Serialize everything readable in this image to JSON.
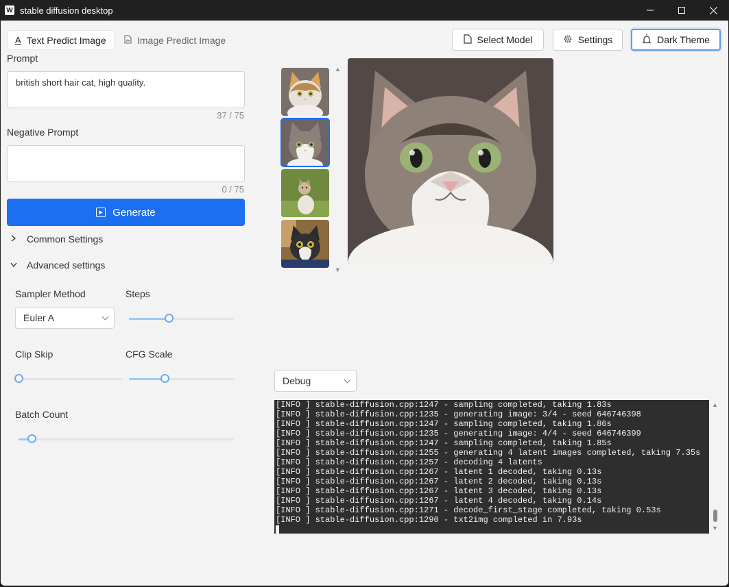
{
  "window": {
    "app_icon": "W",
    "title": "stable diffusion desktop",
    "minimize_icon": "minimize-icon",
    "maximize_icon": "maximize-icon",
    "close_icon": "close-icon"
  },
  "tabs": [
    {
      "label": "Text Predict Image",
      "icon": "text-icon",
      "active": true
    },
    {
      "label": "Image Predict Image",
      "icon": "image-file-icon",
      "active": false
    }
  ],
  "toolbar": {
    "select_model": "Select Model",
    "settings": "Settings",
    "dark_theme": "Dark Theme"
  },
  "prompt": {
    "label": "Prompt",
    "value": "british short hair cat, high quality.",
    "counter": "37 / 75"
  },
  "negative_prompt": {
    "label": "Negative Prompt",
    "value": "",
    "counter": "0 / 75"
  },
  "generate_label": "Generate",
  "common_settings": "Common Settings",
  "advanced_settings": "Advanced settings",
  "sampler": {
    "label": "Sampler Method",
    "value": "Euler A"
  },
  "steps": {
    "label": "Steps",
    "level": 0.38
  },
  "clip_skip": {
    "label": "Clip Skip",
    "level": 0.0
  },
  "cfg_scale": {
    "label": "CFG Scale",
    "level": 0.34
  },
  "batch_count": {
    "label": "Batch Count",
    "level": 0.06
  },
  "log_level": "Debug",
  "log_lines": [
    "[INFO ] stable-diffusion.cpp:1247 - sampling completed, taking 1.83s",
    "[INFO ] stable-diffusion.cpp:1235 - generating image: 3/4 - seed 646746398",
    "[INFO ] stable-diffusion.cpp:1247 - sampling completed, taking 1.86s",
    "[INFO ] stable-diffusion.cpp:1235 - generating image: 4/4 - seed 646746399",
    "[INFO ] stable-diffusion.cpp:1247 - sampling completed, taking 1.85s",
    "[INFO ] stable-diffusion.cpp:1255 - generating 4 latent images completed, taking 7.35s",
    "[INFO ] stable-diffusion.cpp:1257 - decoding 4 latents",
    "[INFO ] stable-diffusion.cpp:1267 - latent 1 decoded, taking 0.13s",
    "[INFO ] stable-diffusion.cpp:1267 - latent 2 decoded, taking 0.13s",
    "[INFO ] stable-diffusion.cpp:1267 - latent 3 decoded, taking 0.13s",
    "[INFO ] stable-diffusion.cpp:1267 - latent 4 decoded, taking 0.14s",
    "[INFO ] stable-diffusion.cpp:1271 - decode_first_stage completed, taking 0.53s",
    "[INFO ] stable-diffusion.cpp:1290 - txt2img completed in 7.93s"
  ],
  "colors": {
    "accent": "#1c6ff0",
    "slider": "#6aaaf0",
    "log_bg": "#2e2e2e"
  }
}
